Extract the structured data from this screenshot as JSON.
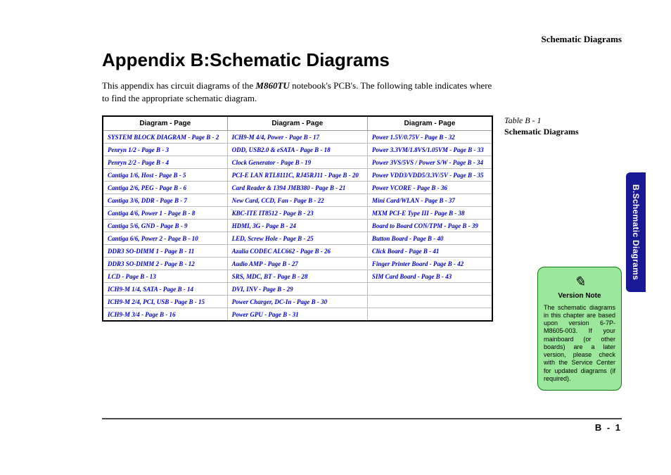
{
  "header": {
    "section_label": "Schematic  Diagrams"
  },
  "title": "Appendix B:Schematic Diagrams",
  "intro": {
    "before_model": "This appendix has circuit diagrams of the ",
    "model": "M860TU",
    "after_model": " notebook's PCB's. The following table indicates where to find the appropriate schematic diagram."
  },
  "columns": [
    "Diagram - Page",
    "Diagram - Page",
    "Diagram - Page"
  ],
  "rows": [
    [
      "SYSTEM BLOCK DIAGRAM - Page  B - 2",
      "ICH9-M 4/4, Power - Page  B - 17",
      "Power 1.5V/0.75V - Page  B - 32"
    ],
    [
      "Penryn 1/2 - Page  B - 3",
      "ODD, USB2.0 & eSATA - Page  B - 18",
      "Power 3.3VM/1.8VS/1.05VM - Page  B - 33"
    ],
    [
      "Penryn 2/2 - Page  B - 4",
      "Clock Generator - Page  B - 19",
      "Power 3VS/5VS / Power S/W - Page  B - 34"
    ],
    [
      "Cantiga 1/6, Host - Page  B - 5",
      "PCI-E LAN RTL8111C, RJ45RJ11 - Page  B - 20",
      "Power VDD3/VDD5/3.3V/5V - Page  B - 35"
    ],
    [
      "Cantiga 2/6, PEG - Page  B - 6",
      "Card Reader & 1394 JMB380 - Page  B - 21",
      "Power VCORE - Page  B - 36"
    ],
    [
      "Cantiga 3/6, DDR - Page  B - 7",
      "New Card, CCD, Fan - Page  B - 22",
      "Mini Card/WLAN - Page  B - 37"
    ],
    [
      "Cantiga 4/6, Power 1 - Page  B - 8",
      "KBC-ITE IT8512 - Page  B - 23",
      "MXM PCI-E Type III - Page  B - 38"
    ],
    [
      "Cantiga 5/6, GND - Page  B - 9",
      "HDMI, 3G - Page  B - 24",
      "Board to Board CON/TPM - Page  B - 39"
    ],
    [
      "Cantiga 6/6, Power 2 - Page  B - 10",
      "LED, Screw Hole - Page  B - 25",
      "Button Board - Page  B - 40"
    ],
    [
      "DDR3 SO-DIMM 1 - Page  B - 11",
      "Azalia CODEC ALC662 - Page  B - 26",
      "Click Board - Page  B - 41"
    ],
    [
      "DDR3 SO-DIMM 2 - Page  B - 12",
      "Audio AMP - Page  B - 27",
      "Finger Printer Board - Page  B - 42"
    ],
    [
      "LCD - Page  B - 13",
      "SRS, MDC, BT - Page  B - 28",
      "SIM Card Board - Page  B - 43"
    ],
    [
      "ICH9-M 1/4, SATA - Page  B - 14",
      "DVI, INV - Page  B - 29",
      ""
    ],
    [
      "ICH9-M 2/4, PCI, USB - Page  B - 15",
      "Power Charger, DC-In - Page  B - 30",
      ""
    ],
    [
      "ICH9-M 3/4 - Page  B - 16",
      "Power GPU - Page  B - 31",
      ""
    ]
  ],
  "side_table_caption": {
    "label": "Table B - 1",
    "name": "Schematic Diagrams"
  },
  "version_note": {
    "icon": "✎",
    "title": "Version Note",
    "body": "The schematic diagrams in this chapter are based upon version 6-7P-M8605-003. If your mainboard (or other boards) are a later version, please check with the Service Center for updated diagrams (if required)."
  },
  "side_tab": "B.Schematic Diagrams",
  "footer": {
    "page_number": "B - 1"
  }
}
